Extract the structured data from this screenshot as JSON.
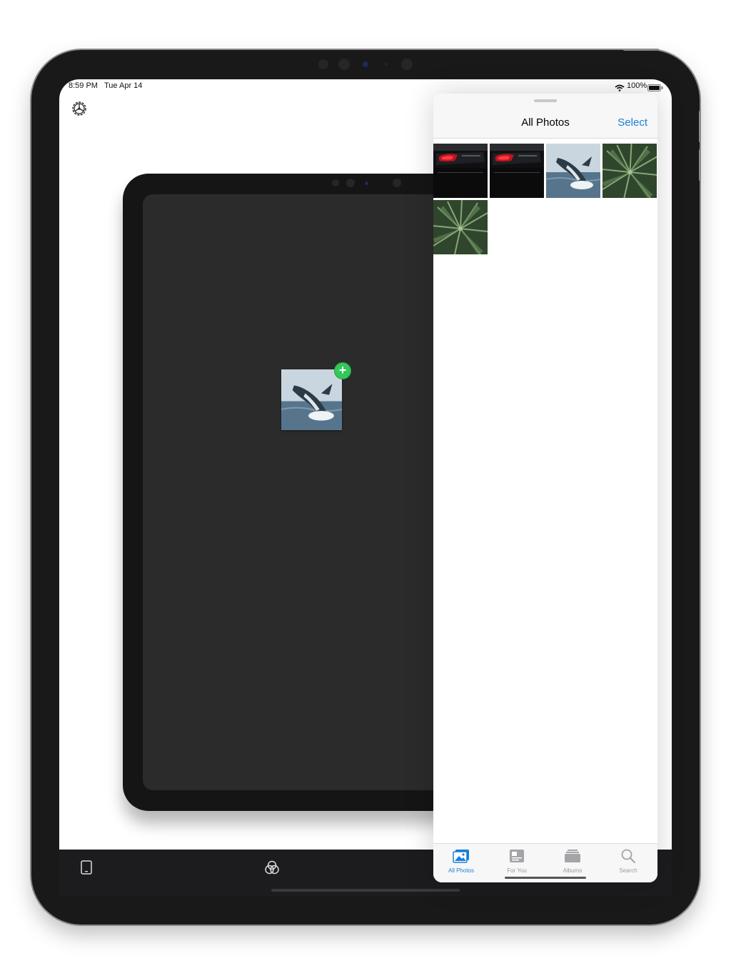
{
  "status_bar": {
    "time": "8:59 PM",
    "date": "Tue Apr 14",
    "battery": "100%"
  },
  "app": {
    "settings_icon": "gear-icon",
    "toolbar": {
      "device_icon": "ipad-icon",
      "filters_icon": "overlapping-circles-icon"
    },
    "dropped_photo": {
      "subject": "whale",
      "badge": "+",
      "badge_color": "#34c759"
    }
  },
  "picker": {
    "title": "All Photos",
    "select_label": "Select",
    "accent_color": "#1a7fd6",
    "photos": [
      {
        "subject": "car-red"
      },
      {
        "subject": "car-red"
      },
      {
        "subject": "whale"
      },
      {
        "subject": "palm-leaves"
      },
      {
        "subject": "palm-leaves"
      }
    ],
    "tabs": [
      {
        "label": "All Photos",
        "icon": "photos-icon",
        "active": true
      },
      {
        "label": "For You",
        "icon": "for-you-icon",
        "active": false
      },
      {
        "label": "Albums",
        "icon": "albums-icon",
        "active": false
      },
      {
        "label": "Search",
        "icon": "search-icon",
        "active": false
      }
    ]
  }
}
